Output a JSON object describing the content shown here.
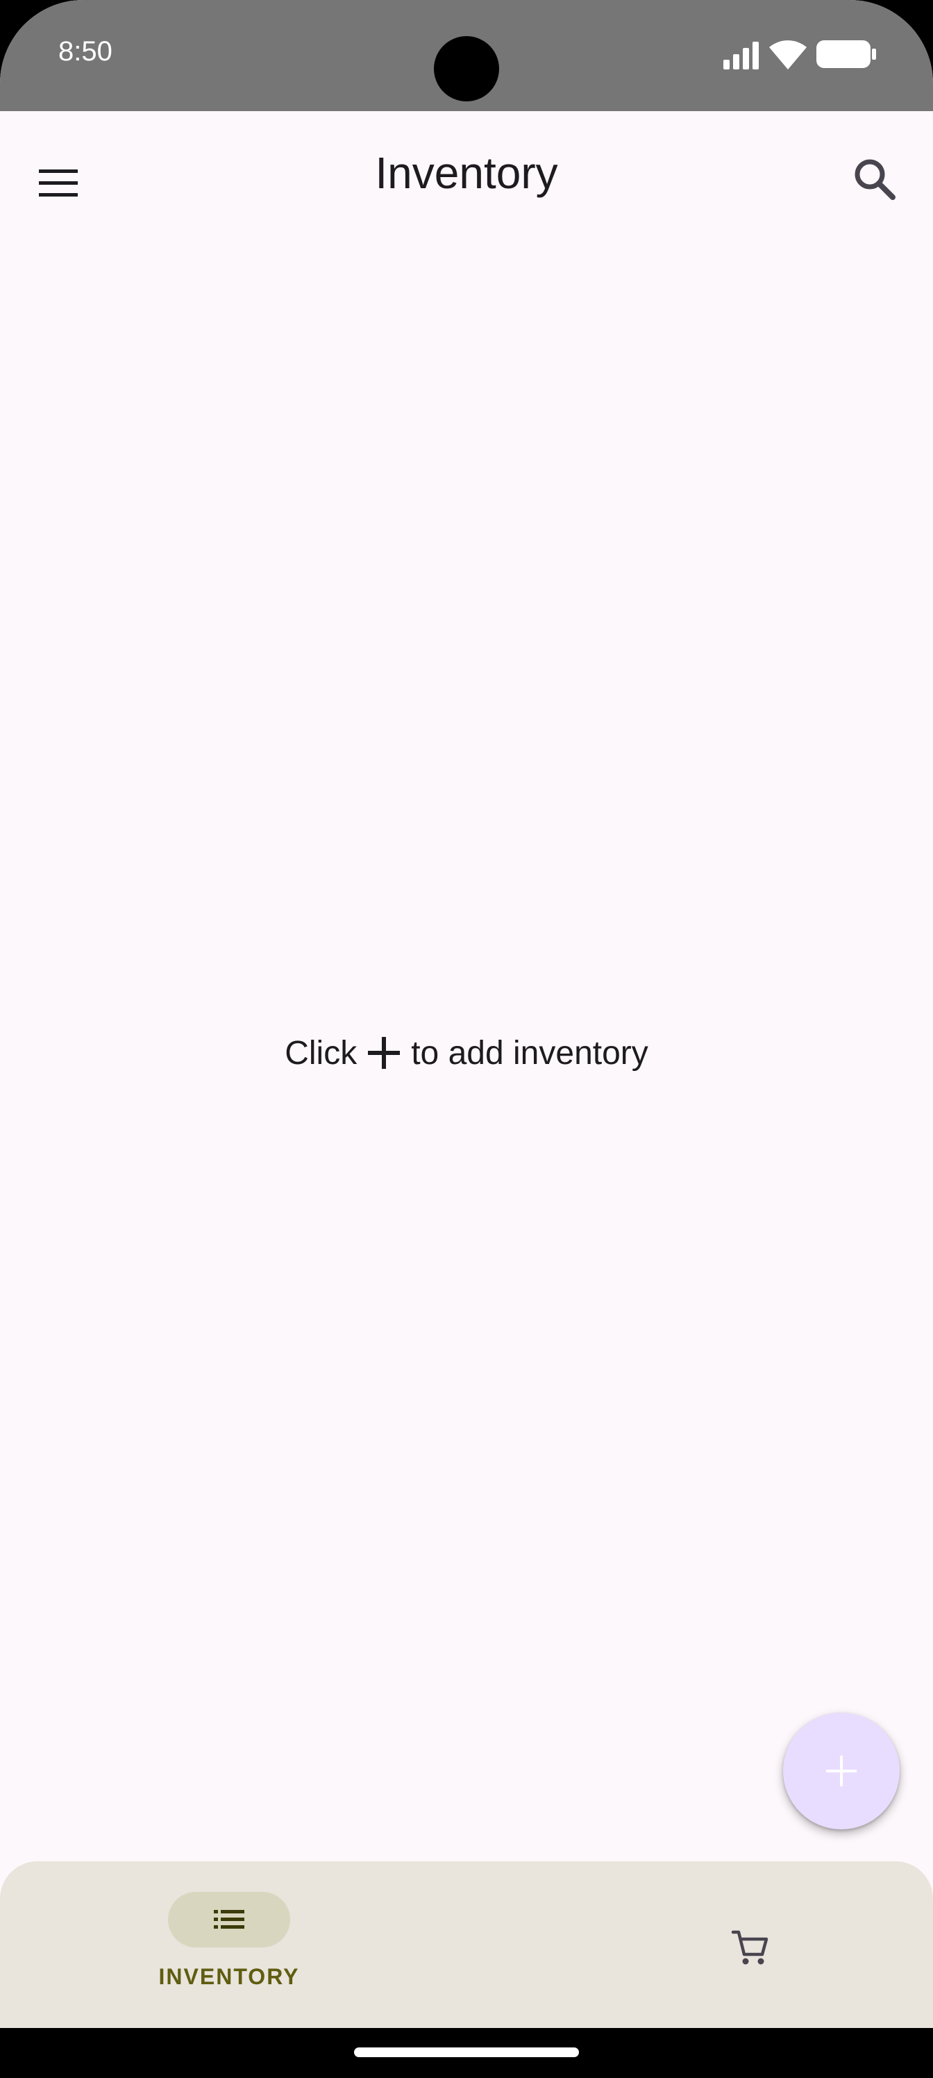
{
  "status_bar": {
    "time": "8:50",
    "icons": [
      "signal-icon",
      "wifi-icon",
      "battery-icon"
    ]
  },
  "app_bar": {
    "title": "Inventory",
    "left_icon": "menu-icon",
    "right_icon": "search-icon"
  },
  "empty_state": {
    "prefix": "Click",
    "icon": "plus-icon",
    "suffix": "to add inventory"
  },
  "fab": {
    "icon": "plus-icon",
    "color": "#e9ddff"
  },
  "bottom_nav": {
    "items": [
      {
        "label": "INVENTORY",
        "icon": "list-icon",
        "selected": true
      },
      {
        "label": "",
        "icon": "cart-icon",
        "selected": false
      }
    ],
    "selected_color": "#5f5d10",
    "background": "#e9e4dc"
  },
  "theme": {
    "surface": "#fdf8fc",
    "status_bar": "#767676",
    "text": "#1d1b20"
  }
}
